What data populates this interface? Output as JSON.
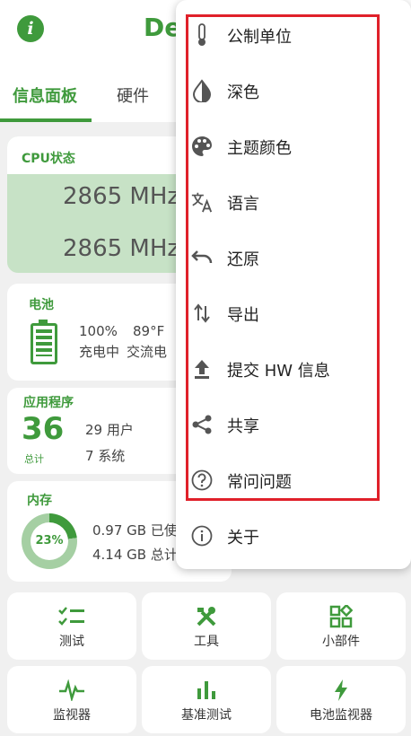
{
  "app_title": "De",
  "tabs": [
    {
      "label": "信息面板",
      "active": true
    },
    {
      "label": "硬件",
      "active": false
    }
  ],
  "cpu": {
    "title": "CPU状态",
    "freqs": [
      "2865 MHz",
      "2865 MHz"
    ]
  },
  "battery": {
    "title": "电池",
    "percent": "100%",
    "temp": "89°F",
    "status": "充电中",
    "source": "交流电"
  },
  "apps": {
    "title": "应用程序",
    "total": "36",
    "total_label": "总计",
    "user": "29 用户",
    "system": "7 系统"
  },
  "memory": {
    "title": "内存",
    "percent": "23%",
    "used": "0.97 GB 已使",
    "total": "4.14 GB 总计"
  },
  "grid": [
    {
      "label": "测试",
      "icon": "checklist-icon"
    },
    {
      "label": "工具",
      "icon": "tools-icon"
    },
    {
      "label": "小部件",
      "icon": "widgets-icon"
    },
    {
      "label": "监视器",
      "icon": "monitor-pulse-icon"
    },
    {
      "label": "基准测试",
      "icon": "bar-chart-icon"
    },
    {
      "label": "电池监视器",
      "icon": "bolt-icon"
    }
  ],
  "menu": {
    "items": [
      {
        "label": "公制单位",
        "icon": "thermometer-icon"
      },
      {
        "label": "深色",
        "icon": "contrast-icon"
      },
      {
        "label": "主题颜色",
        "icon": "palette-icon"
      },
      {
        "label": "语言",
        "icon": "translate-icon"
      },
      {
        "label": "还原",
        "icon": "undo-icon"
      },
      {
        "label": "导出",
        "icon": "swap-vertical-icon"
      },
      {
        "label": "提交 HW 信息",
        "icon": "upload-icon"
      },
      {
        "label": "共享",
        "icon": "share-icon"
      },
      {
        "label": "常问问题",
        "icon": "help-circle-icon"
      },
      {
        "label": "关于",
        "icon": "info-outline-icon"
      }
    ]
  },
  "colors": {
    "accent": "#3f9a3c",
    "highlight": "#e0202a"
  }
}
